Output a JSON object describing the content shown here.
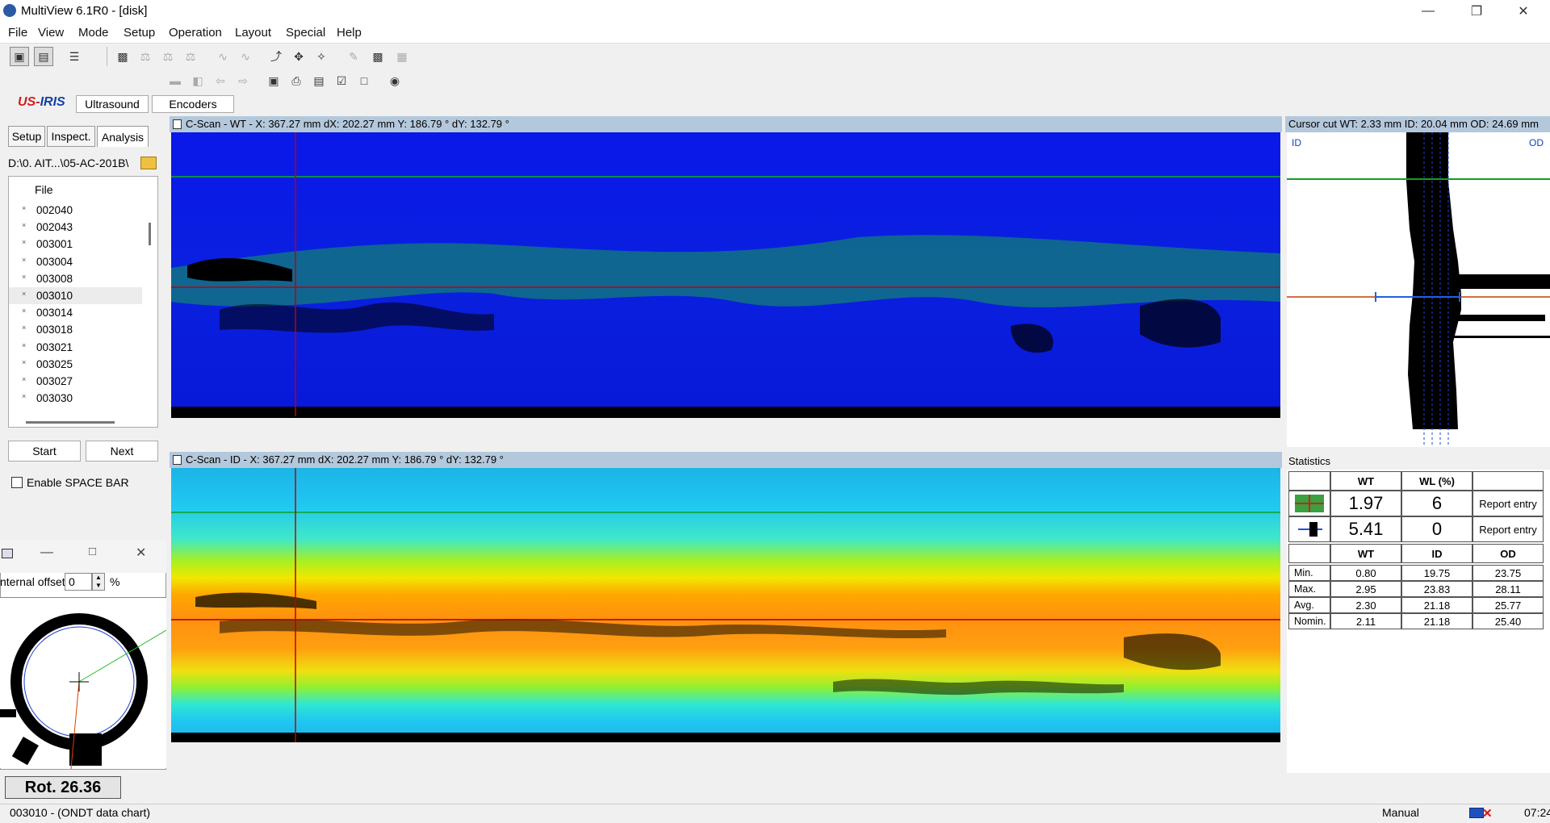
{
  "window": {
    "title": "MultiView 6.1R0 - [disk]"
  },
  "menu": [
    "File",
    "View",
    "Mode",
    "Setup",
    "Operation",
    "Layout",
    "Special",
    "Help"
  ],
  "top_tabs": {
    "logo_us": "US-",
    "logo_iris": "IRIS",
    "ultrasound": "Ultrasound",
    "encoders": "Encoders"
  },
  "left_tabs": {
    "setup": "Setup",
    "inspect": "Inspect.",
    "analysis": "Analysis"
  },
  "path": "D:\\0. AIT...\\05-AC-201B\\",
  "file_list": {
    "header": "File",
    "items": [
      {
        "name": "002040",
        "selected": false
      },
      {
        "name": "002043",
        "selected": false
      },
      {
        "name": "003001",
        "selected": false
      },
      {
        "name": "003004",
        "selected": false
      },
      {
        "name": "003008",
        "selected": false
      },
      {
        "name": "003010",
        "selected": true
      },
      {
        "name": "003014",
        "selected": false
      },
      {
        "name": "003018",
        "selected": false
      },
      {
        "name": "003021",
        "selected": false
      },
      {
        "name": "003025",
        "selected": false
      },
      {
        "name": "003027",
        "selected": false
      },
      {
        "name": "003030",
        "selected": false
      }
    ]
  },
  "buttons": {
    "start": "Start",
    "next": "Next"
  },
  "space_bar": {
    "label": "Enable SPACE BAR",
    "checked": false
  },
  "offset": {
    "label": "nternal offset",
    "value": "0",
    "unit": "%"
  },
  "rotation": "Rot. 26.36",
  "cscan_wt": {
    "title": "C-Scan - WT  -  X: 367.27 mm  dX: 202.27 mm    Y: 186.79 °  dY: 132.79 °"
  },
  "cscan_id": {
    "title": "C-Scan - ID  -  X: 367.27 mm  dX: 202.27 mm    Y: 186.79 °  dY: 132.79 °"
  },
  "cursor_cut": {
    "title": "Cursor cut  WT: 2.33 mm  ID: 20.04 mm  OD: 24.69 mm",
    "id_label": "ID",
    "od_label": "OD"
  },
  "statistics": {
    "title": "Statistics",
    "top_headers": [
      "WT",
      "WL (%)"
    ],
    "rows": [
      {
        "wt": "1.97",
        "wl": "6",
        "action": "Report entry",
        "icon": "cursor-red-icon"
      },
      {
        "wt": "5.41",
        "wl": "0",
        "action": "Report entry",
        "icon": "cursor-blue-icon"
      }
    ],
    "headers": [
      "WT",
      "ID",
      "OD"
    ],
    "table": [
      {
        "label": "Min.",
        "wt": "0.80",
        "id": "19.75",
        "od": "23.75"
      },
      {
        "label": "Max.",
        "wt": "2.95",
        "id": "23.83",
        "od": "28.11"
      },
      {
        "label": "Avg.",
        "wt": "2.30",
        "id": "21.18",
        "od": "25.77"
      },
      {
        "label": "Nomin.",
        "wt": "2.11",
        "id": "21.18",
        "od": "25.40"
      }
    ]
  },
  "status": {
    "left": "003010 - (ONDT data chart)",
    "mode": "Manual",
    "time": "07:24"
  },
  "colors": {
    "scan_blue": "#0a1ee6",
    "cursor_red": "#c00000",
    "cursor_green": "#10a020",
    "title_bar": "#b4c8dc"
  }
}
